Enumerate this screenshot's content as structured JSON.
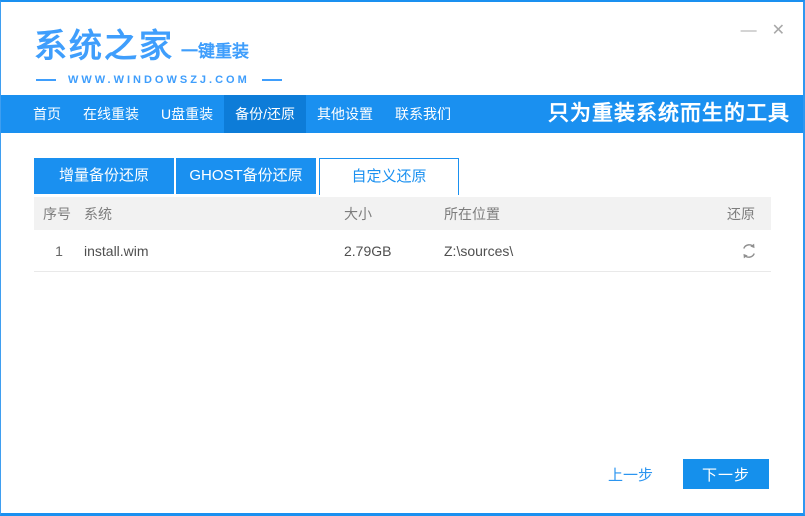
{
  "window": {
    "controls": {
      "minimize": "—",
      "close": "✕"
    }
  },
  "header": {
    "logo": "系统之家",
    "logo_sub": "一键重装",
    "website": "WWW.WINDOWSZJ.COM"
  },
  "navbar": {
    "items": [
      {
        "label": "首页",
        "active": false
      },
      {
        "label": "在线重装",
        "active": false
      },
      {
        "label": "U盘重装",
        "active": false
      },
      {
        "label": "备份/还原",
        "active": true
      },
      {
        "label": "其他设置",
        "active": false
      },
      {
        "label": "联系我们",
        "active": false
      }
    ],
    "slogan": "只为重装系统而生的工具"
  },
  "tabs": [
    {
      "label": "增量备份还原",
      "active": false
    },
    {
      "label": "GHOST备份还原",
      "active": false
    },
    {
      "label": "自定义还原",
      "active": true
    }
  ],
  "table": {
    "columns": [
      "序号",
      "系统",
      "大小",
      "所在位置",
      "还原"
    ],
    "rows": [
      {
        "index": "1",
        "system": "install.wim",
        "size": "2.79GB",
        "location": "Z:\\sources\\",
        "action_icon": "refresh-icon"
      }
    ]
  },
  "footer": {
    "prev_label": "上一步",
    "next_label": "下一步"
  },
  "colors": {
    "primary": "#1a90f0",
    "nav_active": "#0d7cd8",
    "logo_blue": "#3f9efc",
    "header_band": "#f2f2f2",
    "row_text": "#4f4f4f"
  }
}
